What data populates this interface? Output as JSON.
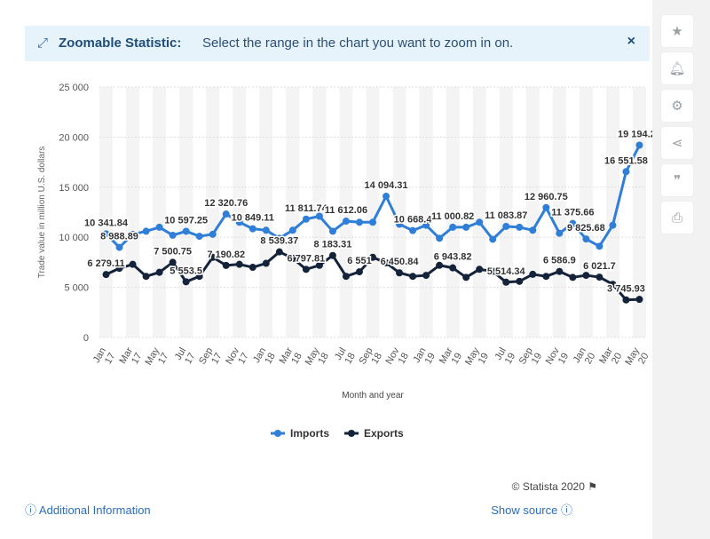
{
  "banner": {
    "title": "Zoomable Statistic:",
    "text": "Select the range in the chart you want to zoom in on."
  },
  "sidebar_icons": [
    "star-icon",
    "bell-icon",
    "gear-icon",
    "share-icon",
    "quote-icon",
    "print-icon"
  ],
  "footer": {
    "copyright": "© Statista 2020",
    "additional_info": "Additional Information",
    "show_source": "Show source"
  },
  "colors": {
    "imports": "#2f7ed8",
    "exports": "#14233a",
    "accent": "#2a6ebb"
  },
  "chart_data": {
    "type": "line",
    "title": "",
    "xlabel": "Month and year",
    "ylabel": "Trade value in million U.S. dollars",
    "ylim": [
      0,
      25000
    ],
    "yticks": [
      0,
      5000,
      10000,
      15000,
      20000,
      25000
    ],
    "ytick_labels": [
      "0",
      "5 000",
      "10 000",
      "15 000",
      "20 000",
      "25 000"
    ],
    "x_tick_labels": [
      [
        "Jan",
        "17"
      ],
      [
        "Mar",
        "17"
      ],
      [
        "May",
        "17"
      ],
      [
        "Jul",
        "17"
      ],
      [
        "Sep",
        "17"
      ],
      [
        "Nov",
        "17"
      ],
      [
        "Jan",
        "18"
      ],
      [
        "Mar",
        "18"
      ],
      [
        "May",
        "18"
      ],
      [
        "Jul",
        "18"
      ],
      [
        "Sep",
        "18"
      ],
      [
        "Nov",
        "18"
      ],
      [
        "Jan",
        "19"
      ],
      [
        "Mar",
        "19"
      ],
      [
        "May",
        "19"
      ],
      [
        "Jul",
        "19"
      ],
      [
        "Sep",
        "19"
      ],
      [
        "Nov",
        "19"
      ],
      [
        "Jan",
        "20"
      ],
      [
        "Mar",
        "20"
      ],
      [
        "May",
        "20"
      ]
    ],
    "categories": [
      "Jan 17",
      "Feb 17",
      "Mar 17",
      "Apr 17",
      "May 17",
      "Jun 17",
      "Jul 17",
      "Aug 17",
      "Sep 17",
      "Oct 17",
      "Nov 17",
      "Dec 17",
      "Jan 18",
      "Feb 18",
      "Mar 18",
      "Apr 18",
      "May 18",
      "Jun 18",
      "Jul 18",
      "Aug 18",
      "Sep 18",
      "Oct 18",
      "Nov 18",
      "Dec 18",
      "Jan 19",
      "Feb 19",
      "Mar 19",
      "Apr 19",
      "May 19",
      "Jun 19",
      "Jul 19",
      "Aug 19",
      "Sep 19",
      "Oct 19",
      "Nov 19",
      "Dec 19",
      "Jan 20",
      "Feb 20",
      "Mar 20",
      "Apr 20",
      "May 20"
    ],
    "grid": true,
    "legend_position": "bottom-center",
    "series": [
      {
        "name": "Imports",
        "values": [
          10341.84,
          8988.89,
          10300,
          10600,
          11000,
          10200,
          10597.25,
          10100,
          10300,
          12320.76,
          11500,
          10849.11,
          10700,
          9900,
          10700,
          11811.74,
          12100,
          10600,
          11612.06,
          11500,
          11500,
          14094.31,
          11300,
          10668.4,
          11200,
          9900,
          11000.82,
          11000,
          11500,
          9800,
          11083.87,
          11000,
          10700,
          12960.75,
          10400,
          11375.66,
          9825.68,
          9100,
          11200,
          16551.58,
          19194.23
        ],
        "labels": [
          {
            "i": 0,
            "text": "10 341.84"
          },
          {
            "i": 1,
            "text": "8 988.89"
          },
          {
            "i": 6,
            "text": "10 597.25"
          },
          {
            "i": 9,
            "text": "12 320.76"
          },
          {
            "i": 11,
            "text": "10 849.11"
          },
          {
            "i": 15,
            "text": "11 811.74"
          },
          {
            "i": 18,
            "text": "11 612.06"
          },
          {
            "i": 21,
            "text": "14 094.31"
          },
          {
            "i": 23,
            "text": "10 668.4"
          },
          {
            "i": 26,
            "text": "11 000.82"
          },
          {
            "i": 30,
            "text": "11 083.87"
          },
          {
            "i": 33,
            "text": "12 960.75"
          },
          {
            "i": 35,
            "text": "11 375.66"
          },
          {
            "i": 36,
            "text": "9 825.68"
          },
          {
            "i": 39,
            "text": "16 551.58"
          },
          {
            "i": 40,
            "text": "19 194.23"
          }
        ]
      },
      {
        "name": "Exports",
        "values": [
          6279.11,
          6900,
          7300,
          6100,
          6500,
          7500.75,
          5553.5,
          6100,
          8000,
          7190.82,
          7300,
          7000,
          7400,
          8539.37,
          7900,
          6797.81,
          7200,
          8183.31,
          6100,
          6551,
          8000,
          7450.84,
          6450.84,
          6100,
          6200,
          7200,
          6943.82,
          6000,
          6800,
          6600,
          5514.34,
          5600,
          6300,
          6100,
          6586.9,
          6000,
          6200,
          6021.7,
          5300,
          3745.93,
          3800
        ],
        "labels": [
          {
            "i": 0,
            "text": "6 279.11"
          },
          {
            "i": 5,
            "text": "7 500.75"
          },
          {
            "i": 6,
            "text": "5 553.5"
          },
          {
            "i": 9,
            "text": "7 190.82"
          },
          {
            "i": 13,
            "text": "8 539.37"
          },
          {
            "i": 15,
            "text": "6 797.81"
          },
          {
            "i": 17,
            "text": "8 183.31"
          },
          {
            "i": 19,
            "text": "6 551"
          },
          {
            "i": 22,
            "text": "6 450.84"
          },
          {
            "i": 26,
            "text": "6 943.82"
          },
          {
            "i": 30,
            "text": "5 514.34"
          },
          {
            "i": 34,
            "text": "6 586.9"
          },
          {
            "i": 37,
            "text": "6 021.7"
          },
          {
            "i": 39,
            "text": "3 745.93"
          }
        ]
      }
    ]
  }
}
